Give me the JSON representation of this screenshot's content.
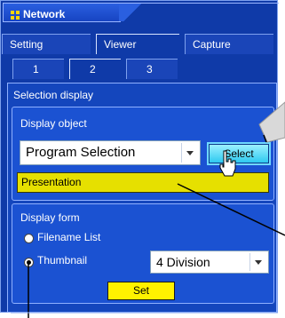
{
  "window": {
    "title": "Network"
  },
  "main_tabs": [
    {
      "label": "Setting",
      "active": false
    },
    {
      "label": "Viewer",
      "active": true
    },
    {
      "label": "Capture",
      "active": false
    }
  ],
  "sub_tabs": [
    {
      "label": "1",
      "active": false
    },
    {
      "label": "2",
      "active": true
    },
    {
      "label": "3",
      "active": false
    }
  ],
  "selection_display": {
    "title": "Selection display",
    "display_object": {
      "label": "Display object",
      "selected": "Program Selection",
      "button": "Select",
      "current_value": "Presentation"
    },
    "display_form": {
      "label": "Display form",
      "options": [
        {
          "label": "Filename List",
          "checked": false
        },
        {
          "label": "Thumbnail",
          "checked": true
        }
      ],
      "division_selected": "4 Division",
      "set_button": "Set"
    }
  },
  "colors": {
    "panel": "#1446bd",
    "accent": "#ffd400",
    "highlight": "#e6e000"
  }
}
